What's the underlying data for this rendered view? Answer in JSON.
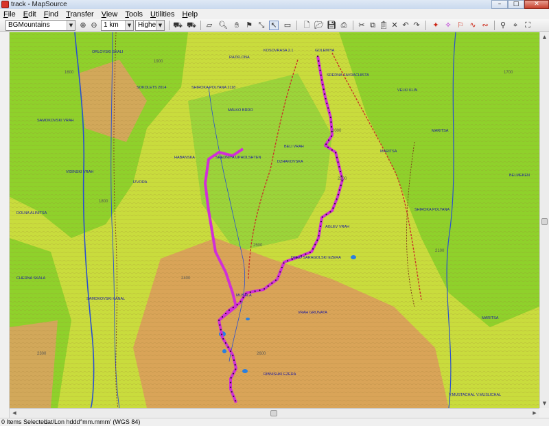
{
  "window": {
    "title": "track - MapSource",
    "minimize_glyph": "–",
    "maximize_glyph": "□",
    "close_glyph": "✕"
  },
  "menu": [
    {
      "label": "File",
      "access": "F",
      "rest": "ile"
    },
    {
      "label": "Edit",
      "access": "E",
      "rest": "dit"
    },
    {
      "label": "Find",
      "access": "F",
      "rest": "ind"
    },
    {
      "label": "Transfer",
      "access": "T",
      "rest": "ransfer"
    },
    {
      "label": "View",
      "access": "V",
      "rest": "iew"
    },
    {
      "label": "Tools",
      "access": "T",
      "rest": "ools"
    },
    {
      "label": "Utilities",
      "access": "U",
      "rest": "tilities"
    },
    {
      "label": "Help",
      "access": "H",
      "rest": "elp"
    }
  ],
  "toolbar": {
    "map_product": "BGMountains",
    "zoom_scale": "1 km",
    "detail_level": "Highest",
    "icons": [
      "zoom-in-icon",
      "zoom-out-icon",
      "map-product-icon",
      "map-product-alt-icon",
      "map-tool-icon",
      "zoom-tool-icon",
      "hand-tool-icon",
      "waypoint-tool-icon",
      "route-tool-icon",
      "selection-tool-icon",
      "measure-tool-icon",
      "new-icon",
      "open-icon",
      "save-icon",
      "print-icon",
      "cut-icon",
      "copy-icon",
      "paste-icon",
      "delete-icon",
      "undo-icon",
      "redo-icon",
      "receive-icon",
      "send-icon",
      "find-icon",
      "find-nearby-icon",
      "zoom-fit-icon"
    ]
  },
  "map": {
    "colors": {
      "lowland": "#c9dc3d",
      "forest": "#8fd12b",
      "highland": "#d9a458",
      "contour": "#9a7a35",
      "river": "#2a4fcf",
      "track": "#d12fd6",
      "track_points": "#3a0f3a",
      "road": "#c8332a"
    },
    "place_labels": [
      "RAZKLONA",
      "KOSOVRASA 2.1",
      "GOLEMIYA",
      "SOKOLETS 2014",
      "SHIROKA POLYANA 2118",
      "MALKO BRDO",
      "SREDNA ZAVRACHISTA",
      "VELKI KLIN",
      "SAMOKOVSKI VRAH",
      "HABANSKA",
      "SREDNIYA UPHOLSHTEN",
      "BELI VRAH",
      "ORLOVSKI SKALI",
      "MARITSA",
      "DENO SARAGOLSKI EZERA",
      "VRAH GRUNATA",
      "MUSALA",
      "AGLEV VRAH",
      "MARITSA",
      "DZHAKOVSKA",
      "SHIROKA POLYANA",
      "VIDINSKI VRAH",
      "DOLNA ALINITSA",
      "SAMOKOVSKI KANAL",
      "IZVORA",
      "RIBNISHKI EZERA",
      "CHERNA SKALA",
      "MARITSA",
      "V.MUSTACHAL",
      "V.MUSLICHAL",
      "BELMEKEN"
    ],
    "elevation_labels": [
      "1900",
      "2000",
      "2200",
      "1800",
      "2300",
      "2400",
      "2500",
      "1700",
      "2100",
      "1600",
      "2600"
    ]
  },
  "status": {
    "selection": "0 Items Selected",
    "coord_format": "Lat/Lon hddd°mm.mmm' (WGS 84)"
  }
}
